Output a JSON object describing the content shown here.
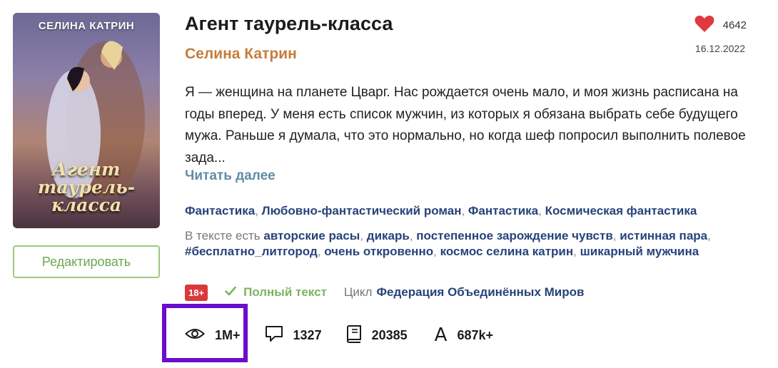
{
  "book": {
    "title": "Агент таурель-класса",
    "author": "Селина Катрин",
    "likes": "4642",
    "date": "16.12.2022",
    "description": "Я — женщина на планете Цварг. Нас рождается очень мало, и моя жизнь расписана на годы вперед. У меня есть список мужчин, из которых я обязана выбрать себе будущего мужа. Раньше я думала, что это нормально, но когда шеф попросил выполнить полевое зада...",
    "read_more": "Читать далее",
    "edit_label": "Редактировать"
  },
  "cover": {
    "author_text": "СЕЛИНА КАТРИН",
    "title_text": "Агент таурель-класса"
  },
  "genres": [
    "Фантастика",
    "Любовно-фантастический роман",
    "Фантастика",
    "Космическая фантастика"
  ],
  "tags": {
    "prefix": "В тексте есть",
    "items": [
      "авторские расы",
      "дикарь",
      "постепенное зарождение чувств",
      "истинная пара",
      "#бесплатно_литгород",
      "очень откровенно",
      "космос селина катрин",
      "шикарный мужчина"
    ]
  },
  "meta": {
    "age": "18+",
    "status": "Полный текст",
    "cycle_label": "Цикл",
    "cycle_name": "Федерация Объединённых Миров"
  },
  "stats": {
    "views": "1M+",
    "comments": "1327",
    "pages": "20385",
    "chars": "687k+"
  },
  "colors": {
    "accent_author": "#c47d3a",
    "link": "#26437a",
    "green": "#7cb460",
    "heart": "#e0393e",
    "highlight": "#6a0dcc"
  },
  "icons": {
    "likes": "heart-icon",
    "status": "check-icon",
    "views": "eye-icon",
    "comments": "comment-icon",
    "pages": "book-icon",
    "chars": "letter-a-icon"
  }
}
